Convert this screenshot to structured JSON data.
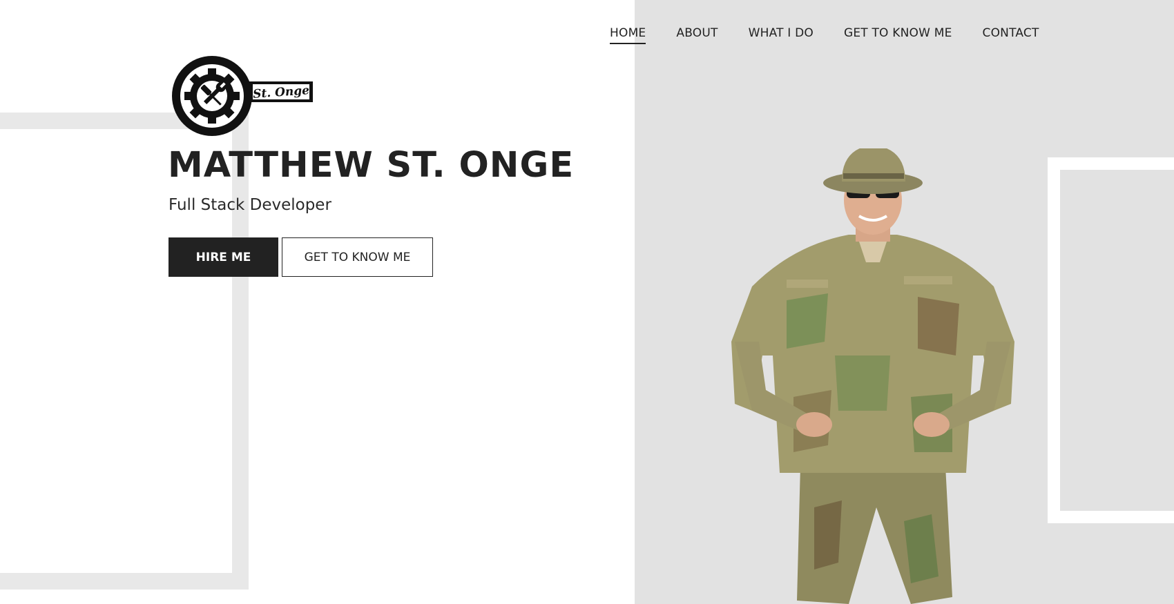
{
  "nav": {
    "items": [
      {
        "label": "HOME",
        "active": true
      },
      {
        "label": "ABOUT"
      },
      {
        "label": "WHAT I DO"
      },
      {
        "label": "GET TO KNOW ME"
      },
      {
        "label": "CONTACT"
      }
    ]
  },
  "logo": {
    "icon": "gear-wrench-screwdriver-logo",
    "text": "St. Onge"
  },
  "hero": {
    "name": "MATTHEW ST. ONGE",
    "tagline": "Full Stack Developer",
    "primary_button": "HIRE ME",
    "secondary_button": "GET TO KNOW ME"
  },
  "colors": {
    "text": "#222222",
    "panel_bg": "#e2e2e2",
    "frame": "#e8e8e8",
    "button_dark": "#222222",
    "camo_base": "#9a9a6a"
  }
}
